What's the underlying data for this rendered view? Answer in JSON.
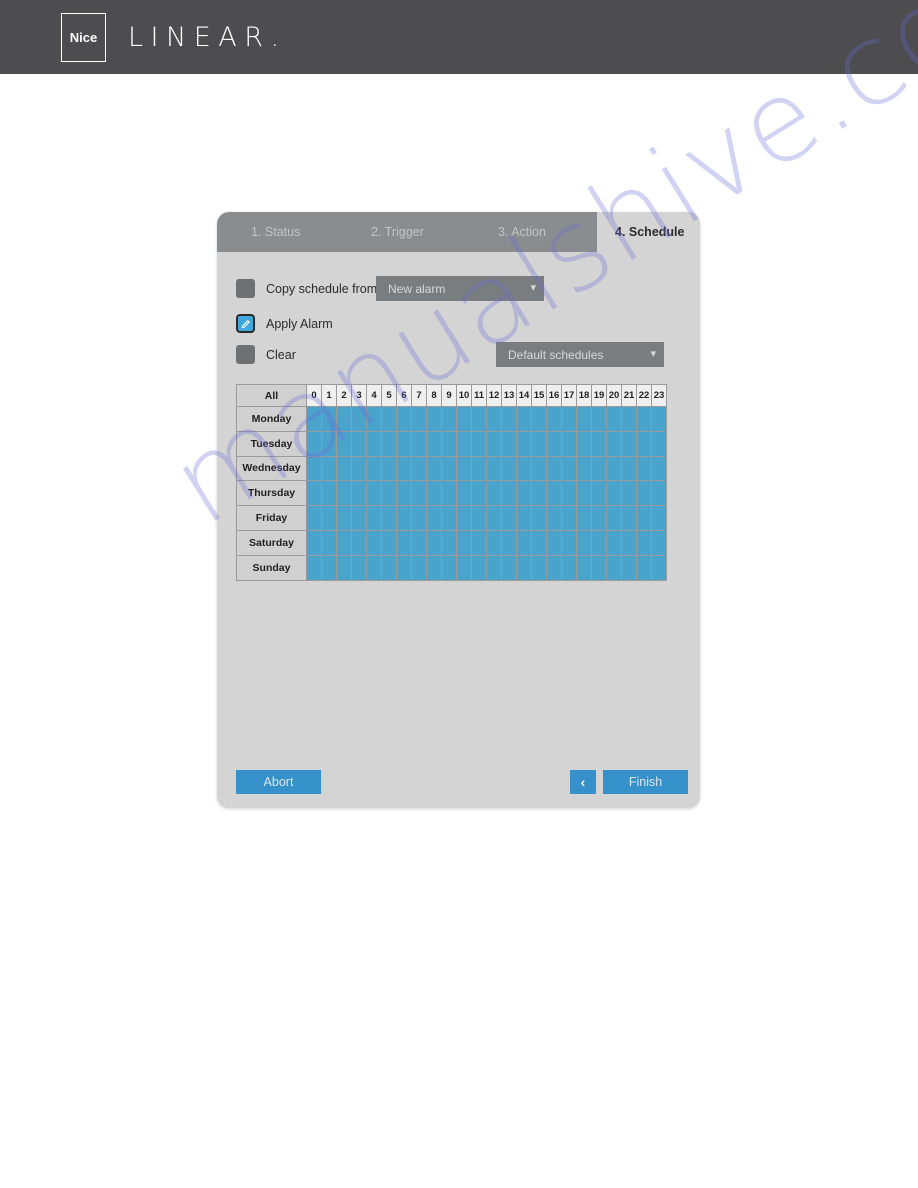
{
  "brand": {
    "badge_text": "Nice",
    "wordmark": "LINEAR",
    "wordmark_dot": ".",
    "bar_color": "#4d4d4f"
  },
  "watermark": {
    "text": "manualshive.com",
    "color": "#6a6ad6"
  },
  "dialog": {
    "background": "#d4d4d4",
    "tabs": [
      {
        "label": "1. Status",
        "active": false
      },
      {
        "label": "2. Trigger",
        "active": false
      },
      {
        "label": "3. Action",
        "active": false
      },
      {
        "label": "4. Schedule",
        "active": true
      }
    ],
    "controls": {
      "copy_schedule": {
        "label": "Copy schedule from",
        "checked": false,
        "dropdown_value": "New alarm",
        "chevron": "chevron-down"
      },
      "apply_alarm": {
        "label": "Apply Alarm",
        "checked": true,
        "icon": "pencil-icon",
        "accent": "#3fa9dd"
      },
      "clear": {
        "label": "Clear",
        "checked": false
      },
      "default_schedules": {
        "dropdown_value": "Default schedules",
        "chevron": "chevron-down"
      }
    },
    "schedule": {
      "all_label": "All",
      "hours": [
        "0",
        "1",
        "2",
        "3",
        "4",
        "5",
        "6",
        "7",
        "8",
        "9",
        "10",
        "11",
        "12",
        "13",
        "14",
        "15",
        "16",
        "17",
        "18",
        "19",
        "20",
        "21",
        "22",
        "23"
      ],
      "days": [
        "Monday",
        "Tuesday",
        "Wednesday",
        "Thursday",
        "Friday",
        "Saturday",
        "Sunday"
      ],
      "selected_color": "#49a3cb",
      "selection": {
        "Monday": [
          1,
          1,
          1,
          1,
          1,
          1,
          1,
          1,
          1,
          1,
          1,
          1,
          1,
          1,
          1,
          1,
          1,
          1,
          1,
          1,
          1,
          1,
          1,
          1
        ],
        "Tuesday": [
          1,
          1,
          1,
          1,
          1,
          1,
          1,
          1,
          1,
          1,
          1,
          1,
          1,
          1,
          1,
          1,
          1,
          1,
          1,
          1,
          1,
          1,
          1,
          1
        ],
        "Wednesday": [
          1,
          1,
          1,
          1,
          1,
          1,
          1,
          1,
          1,
          1,
          1,
          1,
          1,
          1,
          1,
          1,
          1,
          1,
          1,
          1,
          1,
          1,
          1,
          1
        ],
        "Thursday": [
          1,
          1,
          1,
          1,
          1,
          1,
          1,
          1,
          1,
          1,
          1,
          1,
          1,
          1,
          1,
          1,
          1,
          1,
          1,
          1,
          1,
          1,
          1,
          1
        ],
        "Friday": [
          1,
          1,
          1,
          1,
          1,
          1,
          1,
          1,
          1,
          1,
          1,
          1,
          1,
          1,
          1,
          1,
          1,
          1,
          1,
          1,
          1,
          1,
          1,
          1
        ],
        "Saturday": [
          1,
          1,
          1,
          1,
          1,
          1,
          1,
          1,
          1,
          1,
          1,
          1,
          1,
          1,
          1,
          1,
          1,
          1,
          1,
          1,
          1,
          1,
          1,
          1
        ],
        "Sunday": [
          1,
          1,
          1,
          1,
          1,
          1,
          1,
          1,
          1,
          1,
          1,
          1,
          1,
          1,
          1,
          1,
          1,
          1,
          1,
          1,
          1,
          1,
          1,
          1
        ]
      }
    },
    "footer": {
      "abort_label": "Abort",
      "back_label": "‹",
      "finish_label": "Finish",
      "button_color": "#3690c9"
    }
  }
}
